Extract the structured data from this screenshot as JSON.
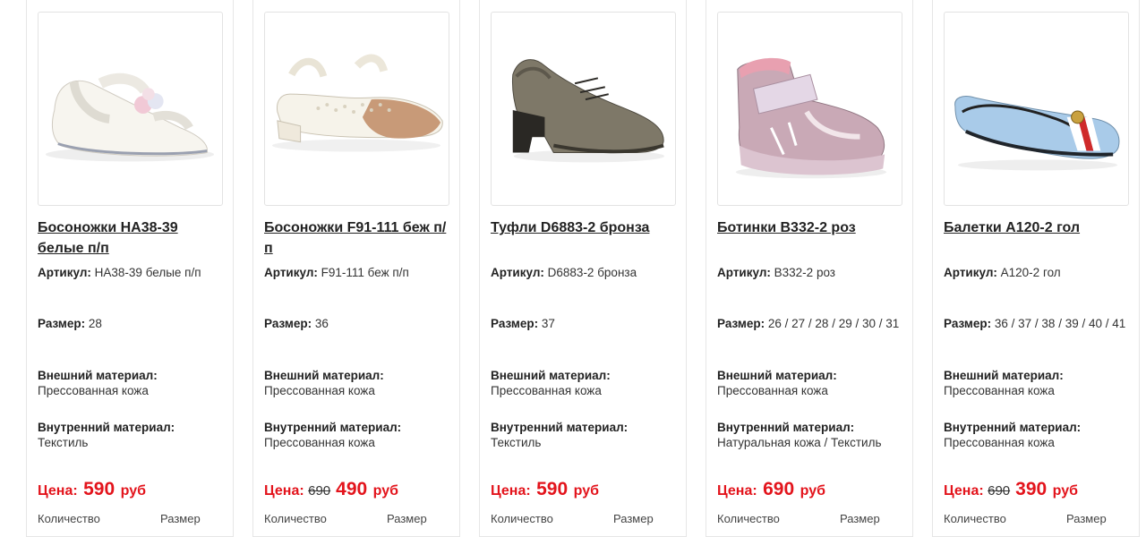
{
  "labels": {
    "article": "Артикул:",
    "size": "Размер:",
    "outer_material": "Внешний материал:",
    "inner_material": "Внутренний материал:",
    "price": "Цена:",
    "currency": "руб",
    "quantity": "Количество",
    "size_select": "Размер"
  },
  "products": [
    {
      "title": "Босоножки НА38-39 белые п/п",
      "article": "НА38-39 белые п/п",
      "size": "28",
      "outer_material": "Прессованная кожа",
      "inner_material": "Текстиль",
      "old_price": "",
      "price": "590",
      "image_icon": "white-sandal-icon"
    },
    {
      "title": "Босоножки F91-111 беж п/п",
      "article": "F91-111 беж п/п",
      "size": "36",
      "outer_material": "Прессованная кожа",
      "inner_material": "Прессованная кожа",
      "old_price": "690",
      "price": "490",
      "image_icon": "beige-sandal-icon"
    },
    {
      "title": "Туфли D6883-2 бронза",
      "article": "D6883-2 бронза",
      "size": "37",
      "outer_material": "Прессованная кожа",
      "inner_material": "Текстиль",
      "old_price": "",
      "price": "590",
      "image_icon": "bronze-shoe-icon"
    },
    {
      "title": "Ботинки B332-2 роз",
      "article": "B332-2 роз",
      "size": "26 / 27 / 28 / 29 / 30 / 31",
      "outer_material": "Прессованная кожа",
      "inner_material": "Натуральная кожа / Текстиль",
      "old_price": "",
      "price": "690",
      "image_icon": "pink-boot-icon"
    },
    {
      "title": "Балетки A120-2 гол",
      "article": "A120-2 гол",
      "size": "36 / 37 / 38 / 39 / 40 / 41",
      "outer_material": "Прессованная кожа",
      "inner_material": "Прессованная кожа",
      "old_price": "690",
      "price": "390",
      "image_icon": "blue-ballet-flat-icon"
    }
  ],
  "colors": {
    "price_red": "#e3141c",
    "border": "#e6e6e6"
  }
}
